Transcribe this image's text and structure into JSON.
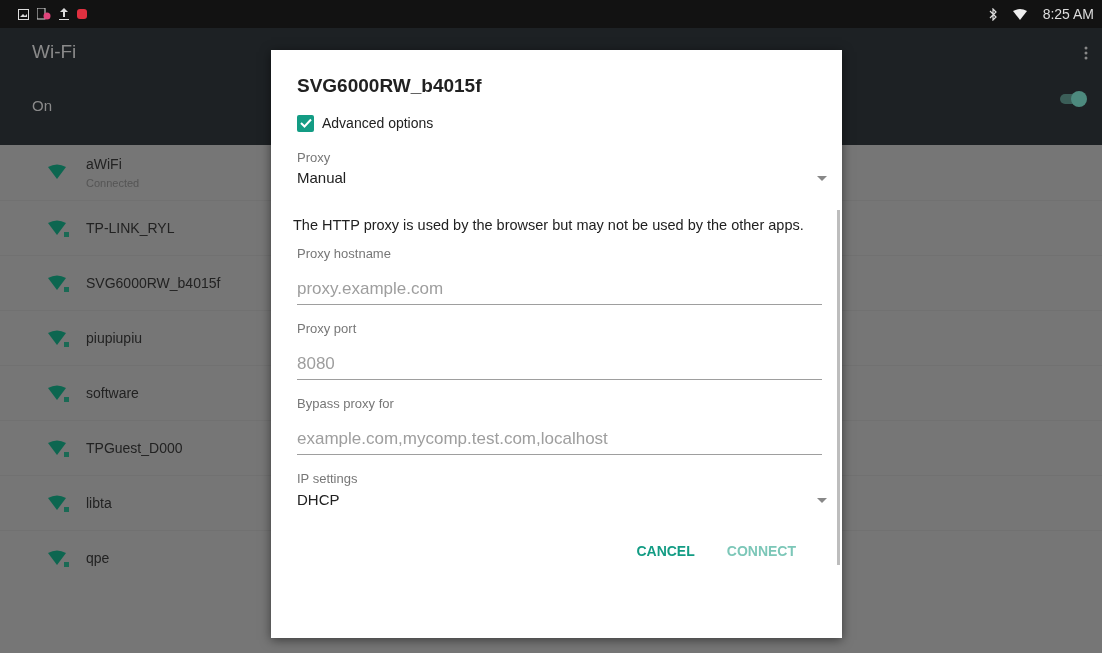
{
  "status_bar": {
    "time": "8:25 AM"
  },
  "app_bar": {
    "title": "Wi-Fi",
    "switch_label": "On",
    "switch_on": true
  },
  "networks": [
    {
      "name": "aWiFi",
      "subtitle": "Connected",
      "secured": false
    },
    {
      "name": "TP-LINK_RYL",
      "secured": true
    },
    {
      "name": "SVG6000RW_b4015f",
      "secured": true
    },
    {
      "name": "piupiupiu",
      "secured": true
    },
    {
      "name": "software",
      "secured": true
    },
    {
      "name": "TPGuest_D000",
      "secured": true
    },
    {
      "name": "libta",
      "secured": true
    },
    {
      "name": "qpe",
      "secured": true
    }
  ],
  "dialog": {
    "title": "SVG6000RW_b4015f",
    "advanced": {
      "label": "Advanced options",
      "checked": true
    },
    "proxy": {
      "label": "Proxy",
      "value": "Manual"
    },
    "note": "The HTTP proxy is used by the browser but may not be used by the other apps.",
    "fields": [
      {
        "label": "Proxy hostname",
        "placeholder": "proxy.example.com"
      },
      {
        "label": "Proxy port",
        "placeholder": "8080"
      },
      {
        "label": "Bypass proxy for",
        "placeholder": "example.com,mycomp.test.com,localhost"
      }
    ],
    "ip_settings": {
      "label": "IP settings",
      "value": "DHCP"
    },
    "buttons": [
      {
        "label": "CANCEL",
        "disabled": false
      },
      {
        "label": "CONNECT",
        "disabled": true
      }
    ]
  }
}
